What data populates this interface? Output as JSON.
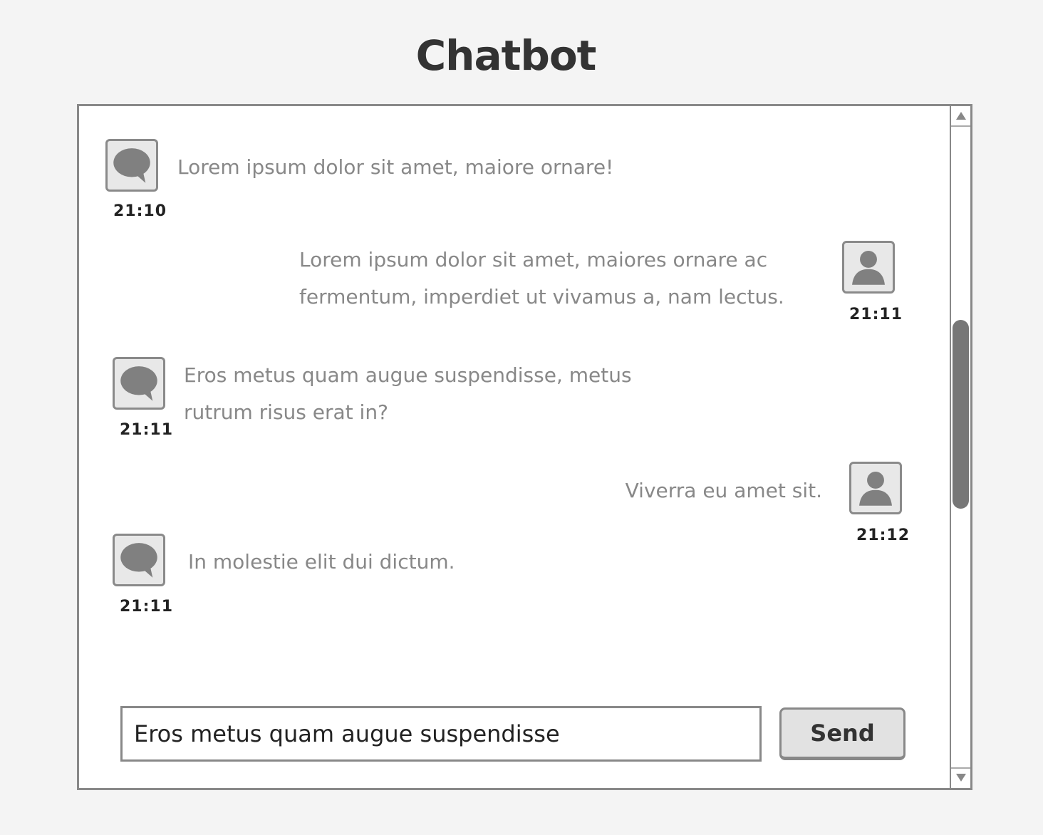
{
  "app": {
    "title": "Chatbot"
  },
  "messages": [
    {
      "sender": "bot",
      "icon": "speech-bubble-icon",
      "text": "Lorem ipsum dolor sit amet, maiore ornare!",
      "time": "21:10"
    },
    {
      "sender": "user",
      "icon": "user-icon",
      "text": "Lorem ipsum dolor sit amet, maiores ornare ac fermentum, imperdiet ut vivamus a, nam lectus.",
      "time": "21:11"
    },
    {
      "sender": "bot",
      "icon": "speech-bubble-icon",
      "text": "Eros metus quam augue suspendisse, metus rutrum risus erat in?",
      "time": "21:11"
    },
    {
      "sender": "user",
      "icon": "user-icon",
      "text": "Viverra eu amet sit.",
      "time": "21:12"
    },
    {
      "sender": "bot",
      "icon": "speech-bubble-icon",
      "text": "In molestie elit dui dictum.",
      "time": "21:11"
    }
  ],
  "composer": {
    "value": "Eros metus quam augue suspendisse",
    "send_label": "Send"
  },
  "colors": {
    "background": "#f4f4f4",
    "border": "#888888",
    "message_text": "#888888",
    "avatar_fill": "#e8e8e8",
    "icon_fill": "#808080",
    "button_fill": "#e2e2e2"
  }
}
